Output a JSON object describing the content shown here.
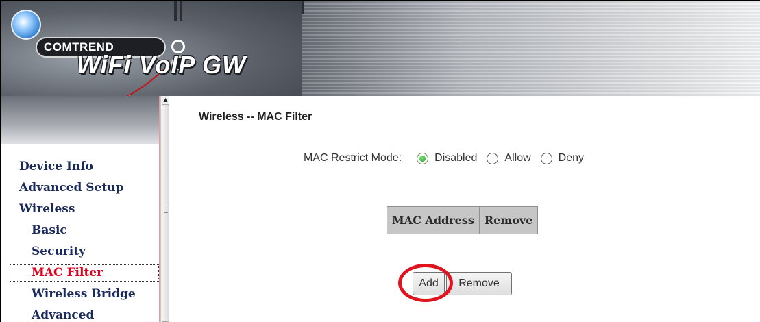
{
  "branding": {
    "company": "COMTREND",
    "product": "WiFi VoIP GW"
  },
  "sidebar": {
    "items": [
      {
        "label": "Device Info"
      },
      {
        "label": "Advanced Setup"
      },
      {
        "label": "Wireless"
      },
      {
        "label": "Basic"
      },
      {
        "label": "Security"
      },
      {
        "label": "MAC Filter"
      },
      {
        "label": "Wireless Bridge"
      },
      {
        "label": "Advanced"
      }
    ],
    "active_item": "MAC Filter"
  },
  "main": {
    "title": "Wireless -- MAC Filter",
    "mode": {
      "label": "MAC Restrict Mode:",
      "options": [
        "Disabled",
        "Allow",
        "Deny"
      ],
      "selected": "Disabled"
    },
    "table": {
      "columns": [
        "MAC Address",
        "Remove"
      ],
      "rows": []
    },
    "buttons": {
      "add": "Add",
      "remove": "Remove"
    }
  },
  "colors": {
    "active_nav": "#e0001b",
    "nav_text": "#1a2a5a",
    "highlight": "#e0141e"
  }
}
